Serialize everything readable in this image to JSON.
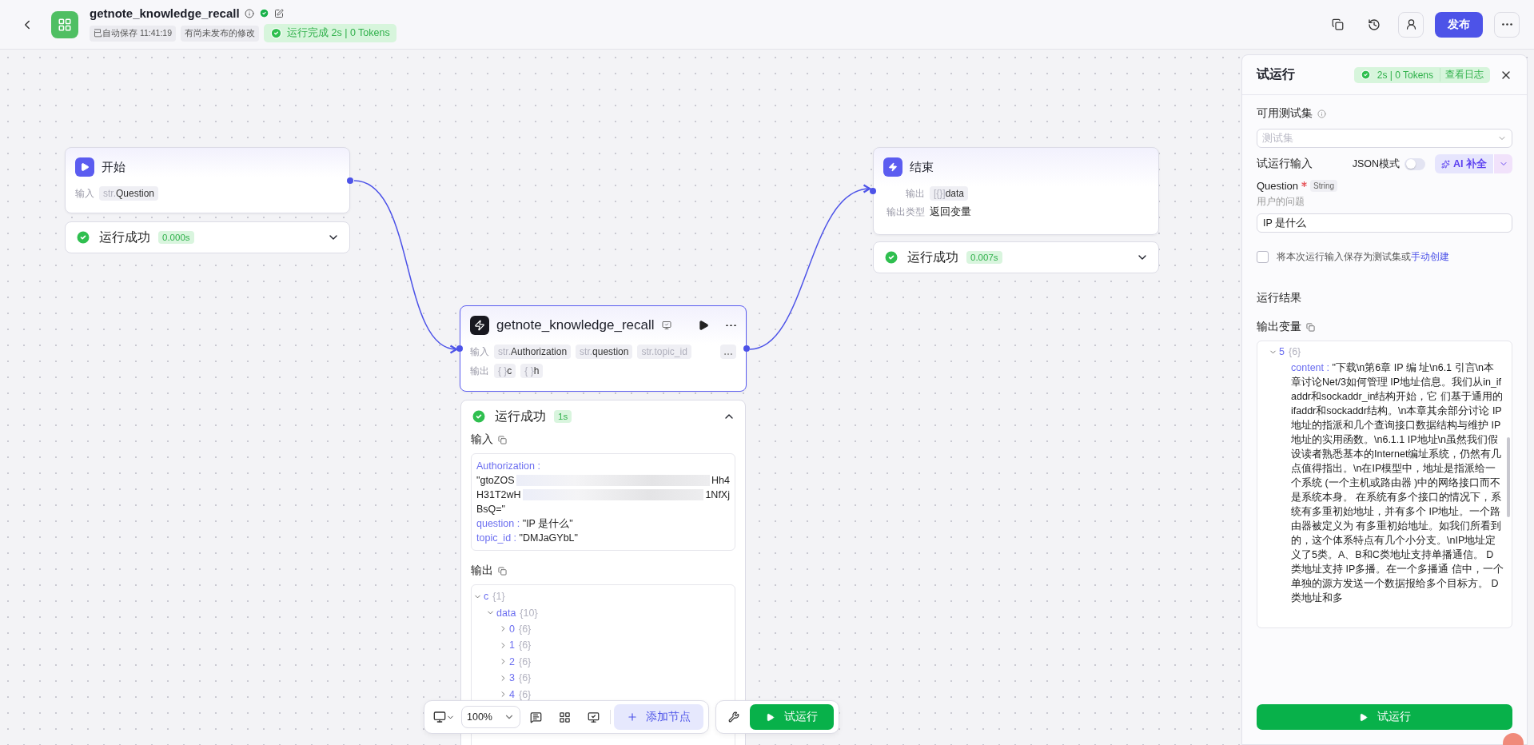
{
  "header": {
    "title": "getnote_knowledge_recall",
    "verified": true,
    "autosave": "已自动保存 11:41:19",
    "unpublished": "有尚未发布的修改",
    "run_status": "运行完成 2s | 0 Tokens",
    "publish": "发布"
  },
  "nodes": [
    {
      "kind": "start",
      "title": "开始",
      "selected": false,
      "rows": [
        {
          "label": "输入",
          "tags": [
            {
              "prefix": "str.",
              "name": "Question"
            }
          ]
        }
      ],
      "status": {
        "text": "运行成功",
        "time": "0.000s",
        "expanded": false
      }
    },
    {
      "kind": "end",
      "title": "结束",
      "selected": false,
      "rows": [
        {
          "label": "输出",
          "tags": [
            {
              "prefix": "[{}]",
              "name": "data"
            }
          ]
        },
        {
          "label": "输出类型",
          "value": "返回变量"
        }
      ],
      "status": {
        "text": "运行成功",
        "time": "0.007s",
        "expanded": false
      }
    },
    {
      "kind": "plugin",
      "title": "getnote_knowledge_recall",
      "selected": true,
      "rows": [
        {
          "label": "输入",
          "tags": [
            {
              "prefix": "str.",
              "name": "Authorization"
            },
            {
              "prefix": "str.",
              "name": "question"
            },
            {
              "prefix": "str.",
              "name": "topic_id",
              "faded": true
            }
          ],
          "more": true
        },
        {
          "label": "输出",
          "tags": [
            {
              "prefix": "{ }",
              "name": "c"
            },
            {
              "prefix": "{ }",
              "name": "h"
            }
          ]
        }
      ],
      "status": {
        "text": "运行成功",
        "time": "1s",
        "expanded": true,
        "input_title": "输入",
        "inputs": [
          {
            "key": "Authorization :",
            "lines": [
              {
                "left": "\"gtoZOS",
                "right": "Hh4"
              },
              {
                "left": "H31T2wH",
                "right": "1NfXj"
              },
              {
                "left": "BsQ=\""
              }
            ]
          },
          {
            "key": "question :",
            "lines": [
              {
                "left": "\"IP 是什么\""
              }
            ]
          },
          {
            "key": "topic_id :",
            "lines": [
              {
                "left": "\"DMJaGYbL\""
              }
            ]
          }
        ],
        "output_title": "输出",
        "tree": [
          {
            "key": "c",
            "count": "{1}",
            "expanded": true,
            "children": [
              {
                "key": "data",
                "count": "{10}",
                "expanded": true,
                "children": [
                  {
                    "key": "0",
                    "count": "{6}",
                    "expanded": false
                  },
                  {
                    "key": "1",
                    "count": "{6}",
                    "expanded": false
                  },
                  {
                    "key": "2",
                    "count": "{6}",
                    "expanded": false
                  },
                  {
                    "key": "3",
                    "count": "{6}",
                    "expanded": false
                  },
                  {
                    "key": "4",
                    "count": "{6}",
                    "expanded": false
                  }
                ]
              }
            ]
          }
        ]
      }
    }
  ],
  "toolbar": {
    "zoom": "100%",
    "add_node": "添加节点",
    "run": "试运行"
  },
  "panel": {
    "title": "试运行",
    "stats": "2s | 0 Tokens",
    "log_link": "查看日志",
    "testset_label": "可用测试集",
    "testset_placeholder": "测试集",
    "input_label": "试运行输入",
    "json_mode": {
      "label": "JSON模式",
      "on": false
    },
    "ai_button": "AI 补全",
    "fields": [
      {
        "name": "Question",
        "required": true,
        "type": "String",
        "description": "用户的问题",
        "value": "IP 是什么"
      }
    ],
    "save": {
      "checked": false,
      "text": "将本次运行输入保存为测试集或",
      "link": "手动创建"
    },
    "result_title": "运行结果",
    "output_title": "输出变量",
    "output": {
      "key": "5",
      "count": "{6}",
      "expanded": true,
      "field": "content :",
      "value": "\"下载\\n第6章 IP 编 址\\n6.1 引言\\n本章讨论Net/3如何管理 IP地址信息。我们从in_ifaddr和sockaddr_in结构开始，它 们基于通用的ifaddr和sockaddr结构。\\n本章其余部分讨论 IP地址的指派和几个查询接口数据结构与维护 IP地址的实用函数。\\n6.1.1 IP地址\\n虽然我们假设读者熟悉基本的Internet编址系统，仍然有几点值得指出。\\n在IP模型中，地址是指派给一个系统 (一个主机或路由器 )中的网络接口而不是系统本身。 在系统有多个接口的情况下，系统有多重初始地址，并有多个 IP地址。一个路由器被定义为 有多重初始地址。如我们所看到的，这个体系特点有几个小分支。\\nIP地址定义了5类。A、B和C类地址支持单播通信。 D类地址支持 IP多播。在一个多播通 信中，一个单独的源方发送一个数据报给多个目标方。 D类地址和多"
    },
    "run_button": "试运行"
  }
}
